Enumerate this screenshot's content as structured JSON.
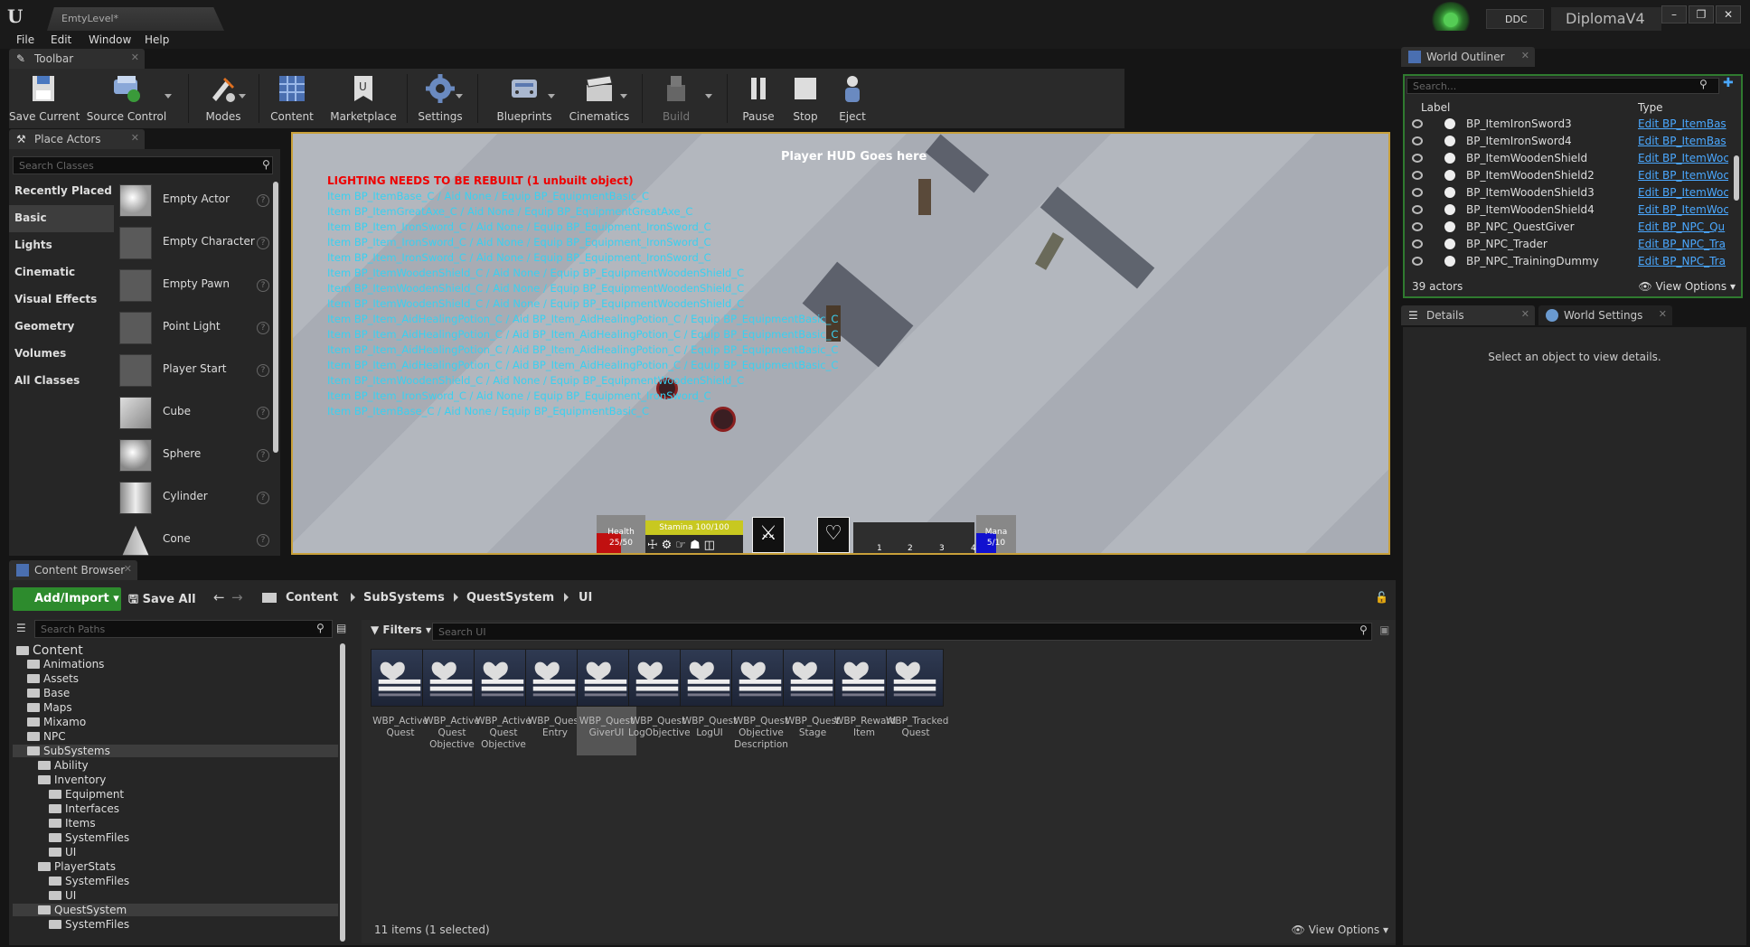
{
  "window": {
    "tab": "EmtyLevel*",
    "ddc": "DDC",
    "project": "DiplomaV4"
  },
  "menu": [
    "File",
    "Edit",
    "Window",
    "Help"
  ],
  "toolbar": {
    "tab": "Toolbar",
    "buttons": [
      "Save Current",
      "Source Control",
      "Modes",
      "Content",
      "Marketplace",
      "Settings",
      "Blueprints",
      "Cinematics",
      "Build",
      "Pause",
      "Stop",
      "Eject"
    ]
  },
  "place_actors": {
    "tab": "Place Actors",
    "search_placeholder": "Search Classes",
    "categories": [
      "Recently Placed",
      "Basic",
      "Lights",
      "Cinematic",
      "Visual Effects",
      "Geometry",
      "Volumes",
      "All Classes"
    ],
    "selected_category": "Basic",
    "actors": [
      "Empty Actor",
      "Empty Character",
      "Empty Pawn",
      "Point Light",
      "Player Start",
      "Cube",
      "Sphere",
      "Cylinder",
      "Cone"
    ]
  },
  "viewport": {
    "hud_title": "Player HUD Goes here",
    "lighting_warning": "LIGHTING NEEDS TO BE REBUILT (1 unbuilt object)",
    "debug_lines": [
      "Item BP_ItemBase_C / Aid None / Equip BP_EquipmentBasic_C",
      "Item BP_ItemGreatAxe_C / Aid  None / Equip BP_EquipmentGreatAxe_C",
      "Item BP_Item_IronSword_C / Aid  None / Equip BP_Equipment_IronSword_C",
      "Item BP_Item_IronSword_C / Aid  None / Equip BP_Equipment_IronSword_C",
      "Item BP_Item_IronSword_C / Aid  None / Equip BP_Equipment_IronSword_C",
      "Item BP_ItemWoodenShield_C / Aid  None / Equip BP_EquipmentWoodenShield_C",
      "Item BP_ItemWoodenShield_C / Aid  None / Equip BP_EquipmentWoodenShield_C",
      "Item BP_ItemWoodenShield_C / Aid  None / Equip BP_EquipmentWoodenShield_C",
      "Item BP_Item_AidHealingPotion_C / Aid BP_Item_AidHealingPotion_C / Equip BP_EquipmentBasic_C",
      "Item BP_Item_AidHealingPotion_C / Aid BP_Item_AidHealingPotion_C / Equip BP_EquipmentBasic_C",
      "Item BP_Item_AidHealingPotion_C / Aid BP_Item_AidHealingPotion_C / Equip BP_EquipmentBasic_C",
      "Item BP_Item_AidHealingPotion_C / Aid BP_Item_AidHealingPotion_C / Equip BP_EquipmentBasic_C",
      "Item BP_ItemWoodenShield_C / Aid  None / Equip BP_EquipmentWoodenShield_C",
      "Item BP_Item_IronSword_C / Aid  None / Equip BP_Equipment_IronSword_C",
      "Item BP_ItemBase_C / Aid  None / Equip BP_EquipmentBasic_C"
    ],
    "hud": {
      "health_label": "Health",
      "health_value": "25/50",
      "health_fill": 0.5,
      "stamina_label": "Stamina 100/100",
      "stamina_fill": 1.0,
      "mana_label": "Mana",
      "mana_value": "5/10",
      "mana_fill": 0.5,
      "slots": [
        "1",
        "2",
        "3",
        "4"
      ]
    }
  },
  "content_browser": {
    "tab": "Content Browser",
    "add_import": "Add/Import",
    "save_all": "Save All",
    "breadcrumb": [
      "Content",
      "SubSystems",
      "QuestSystem",
      "UI"
    ],
    "path_search": "Search Paths",
    "filters": "Filters",
    "asset_search": "Search UI",
    "tree": [
      {
        "label": "Content",
        "indent": 0,
        "big": true
      },
      {
        "label": "Animations",
        "indent": 1
      },
      {
        "label": "Assets",
        "indent": 1
      },
      {
        "label": "Base",
        "indent": 1
      },
      {
        "label": "Maps",
        "indent": 1
      },
      {
        "label": "Mixamo",
        "indent": 1
      },
      {
        "label": "NPC",
        "indent": 1
      },
      {
        "label": "SubSystems",
        "indent": 1,
        "sel": true
      },
      {
        "label": "Ability",
        "indent": 2
      },
      {
        "label": "Inventory",
        "indent": 2
      },
      {
        "label": "Equipment",
        "indent": 3
      },
      {
        "label": "Interfaces",
        "indent": 3
      },
      {
        "label": "Items",
        "indent": 3
      },
      {
        "label": "SystemFiles",
        "indent": 3
      },
      {
        "label": "UI",
        "indent": 3
      },
      {
        "label": "PlayerStats",
        "indent": 2
      },
      {
        "label": "SystemFiles",
        "indent": 3
      },
      {
        "label": "UI",
        "indent": 3
      },
      {
        "label": "QuestSystem",
        "indent": 2,
        "sel": true
      },
      {
        "label": "SystemFiles",
        "indent": 3
      }
    ],
    "assets": [
      "WBP_Active Quest",
      "WBP_Active Quest Objective",
      "WBP_Active Quest Objective",
      "WBP_Quest Entry",
      "WBP_Quest GiverUI",
      "WBP_Quest LogObjective",
      "WBP_Quest LogUI",
      "WBP_Quest Objective Description",
      "WBP_Quest Stage",
      "WBP_Reward Item",
      "WBP_Tracked Quest"
    ],
    "selected_asset": 4,
    "item_count": "11 items (1 selected)",
    "view_options": "View Options"
  },
  "outliner": {
    "tab": "World Outliner",
    "search_placeholder": "Search...",
    "col_label": "Label",
    "col_type": "Type",
    "rows": [
      {
        "name": "BP_ItemIronSword3",
        "type": "Edit BP_ItemBas"
      },
      {
        "name": "BP_ItemIronSword4",
        "type": "Edit BP_ItemBas"
      },
      {
        "name": "BP_ItemWoodenShield",
        "type": "Edit BP_ItemWoc"
      },
      {
        "name": "BP_ItemWoodenShield2",
        "type": "Edit BP_ItemWoc"
      },
      {
        "name": "BP_ItemWoodenShield3",
        "type": "Edit BP_ItemWoc"
      },
      {
        "name": "BP_ItemWoodenShield4",
        "type": "Edit BP_ItemWoc"
      },
      {
        "name": "BP_NPC_QuestGiver",
        "type": "Edit BP_NPC_Qu"
      },
      {
        "name": "BP_NPC_Trader",
        "type": "Edit BP_NPC_Tra"
      },
      {
        "name": "BP_NPC_TrainingDummy",
        "type": "Edit BP_NPC_Tra"
      }
    ],
    "count": "39 actors",
    "view_options": "View Options"
  },
  "details": {
    "tab": "Details",
    "tab2": "World Settings",
    "message": "Select an object to view details."
  }
}
